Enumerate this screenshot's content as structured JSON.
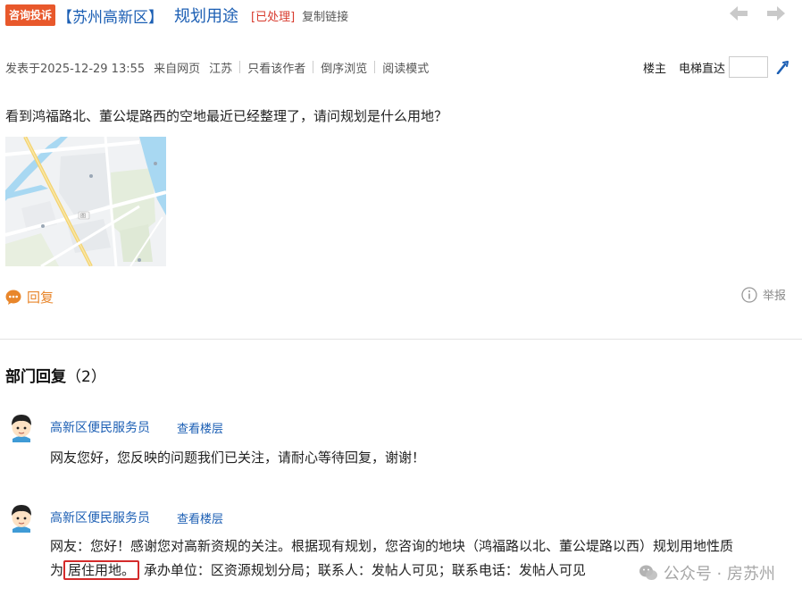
{
  "header": {
    "category_badge": "咨询投诉",
    "region": "【苏州高新区】",
    "subject": "规划用途",
    "status": "[已处理]",
    "copy_link": "复制链接"
  },
  "meta": {
    "posted": "发表于2025-12-29 13:55",
    "source": "来自网页",
    "location": "江苏",
    "only_author": "只看该作者",
    "reverse_order": "倒序浏览",
    "reading_mode": "阅读模式",
    "floor_owner": "楼主",
    "elevator": "电梯直达"
  },
  "post": {
    "question": "看到鸿福路北、董公堤路西的空地最近已经整理了，请问规划是什么用地？",
    "map_marker": "图"
  },
  "actions": {
    "reply": "回复",
    "report": "举报"
  },
  "section": {
    "title": "部门回复",
    "count": "（2）"
  },
  "replies": [
    {
      "replier": "高新区便民服务员",
      "view_floor": "查看楼层",
      "body": "网友您好，您反映的问题我们已关注，请耐心等待回复，谢谢！"
    },
    {
      "replier": "高新区便民服务员",
      "view_floor": "查看楼层",
      "body_line1": "网友：您好！感谢您对高新资规的关注。根据现有规划，您咨询的地块（鸿福路以北、董公堤路以西）规划用地性质",
      "body_pre": "为",
      "body_highlight": "居住用地。",
      "body_post": "承办单位：区资源规划分局；联系人：发帖人可见；联系电话：发帖人可见"
    }
  ],
  "watermark": "公众号 · 房苏州",
  "colors": {
    "badge": "#e8582b",
    "link": "#1c5fb4",
    "status": "#d83b2e",
    "reply_button": "#e8862b",
    "highlight_box": "#d42b2b"
  }
}
